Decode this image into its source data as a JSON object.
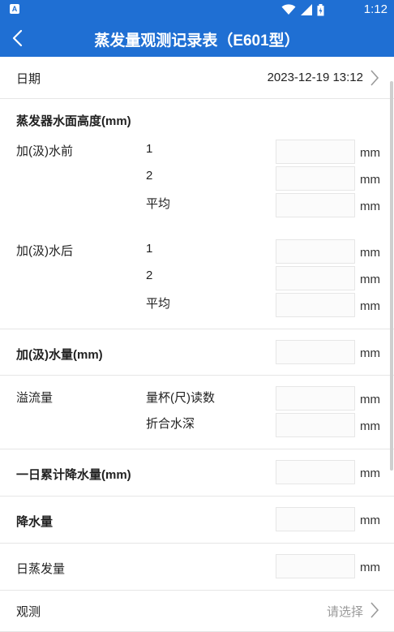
{
  "status": {
    "time": "1:12",
    "app_icon_letter": "A"
  },
  "appbar": {
    "title": "蒸发量观测记录表（E601型）"
  },
  "date_row": {
    "label": "日期",
    "value": "2023-12-19 13:12"
  },
  "section_height": {
    "title": "蒸发器水面高度(mm)",
    "before": {
      "label": "加(汲)水前",
      "rows": [
        "1",
        "2",
        "平均"
      ]
    },
    "after": {
      "label": "加(汲)水后",
      "rows": [
        "1",
        "2",
        "平均"
      ]
    }
  },
  "add_water": {
    "label": "加(汲)水量(mm)"
  },
  "overflow": {
    "label": "溢流量",
    "rows": [
      "量杯(尺)读数",
      "折合水深"
    ]
  },
  "daily_precip": {
    "label": "一日累计降水量(mm)"
  },
  "precip": {
    "label": "降水量"
  },
  "evap": {
    "label": "日蒸发量"
  },
  "observe": {
    "label": "观测",
    "placeholder": "请选择"
  },
  "unit": "mm",
  "colors": {
    "primary": "#1f6fd3",
    "divider": "#e6e6e6",
    "placeholder": "#9a9a9a"
  }
}
